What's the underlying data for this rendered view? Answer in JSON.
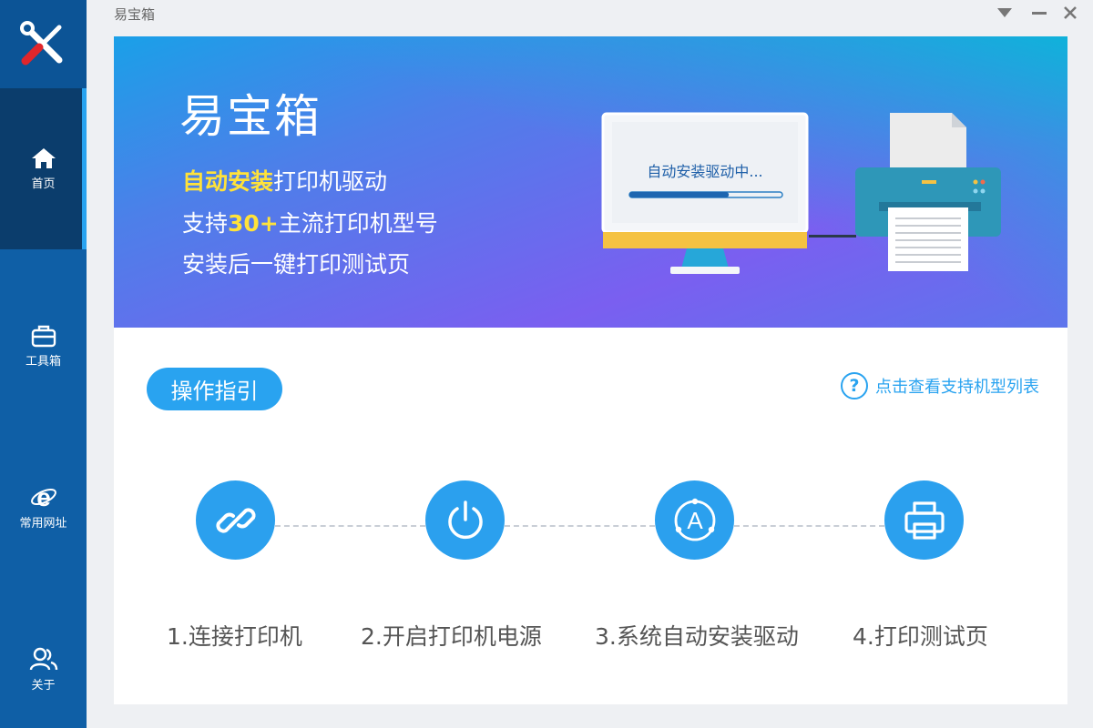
{
  "window": {
    "title": "易宝箱"
  },
  "sidebar": {
    "items": [
      {
        "label": "首页",
        "icon": "home-icon"
      },
      {
        "label": "工具箱",
        "icon": "toolbox-icon"
      },
      {
        "label": "常用网址",
        "icon": "ie-browser-icon"
      },
      {
        "label": "关于",
        "icon": "users-icon"
      }
    ]
  },
  "banner": {
    "title": "易宝箱",
    "line1_highlight": "自动安装",
    "line1_rest": "打印机驱动",
    "line2_prefix": "支持",
    "line2_highlight": "30+",
    "line2_rest": "主流打印机型号",
    "line3": "安装后一键打印测试页",
    "monitor_status": "自动安装驱动中...",
    "install_progress": 0.65
  },
  "guide": {
    "pill_label": "操作指引",
    "help_link": "点击查看支持机型列表"
  },
  "steps": [
    {
      "label": "1.连接打印机",
      "icon": "link-icon"
    },
    {
      "label": "2.开启打印机电源",
      "icon": "power-icon"
    },
    {
      "label": "3.系统自动安装驱动",
      "icon": "auto-install-icon"
    },
    {
      "label": "4.打印测试页",
      "icon": "printer-icon"
    }
  ],
  "colors": {
    "sidebar": "#0f5fa6",
    "sidebar_active": "#0b3d6c",
    "accent": "#29a3f0",
    "highlight": "#ffe23a"
  }
}
